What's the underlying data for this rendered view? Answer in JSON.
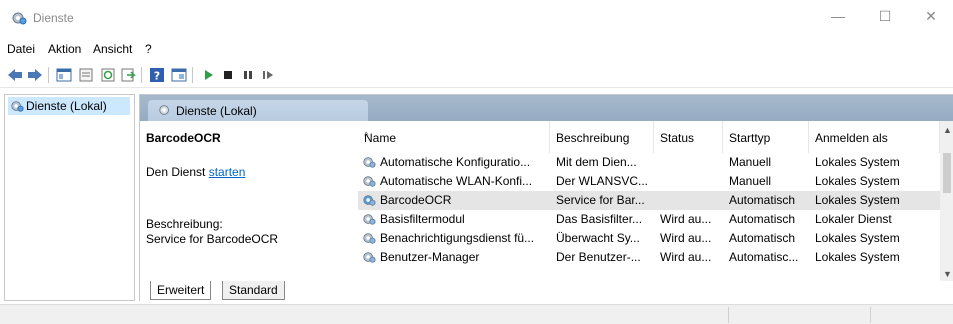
{
  "window": {
    "title": "Dienste",
    "minimize": "—",
    "maximize": "☐",
    "close": "✕"
  },
  "menu": {
    "items": [
      "Datei",
      "Aktion",
      "Ansicht",
      "?"
    ]
  },
  "toolbar": {
    "icons": [
      "back-icon",
      "forward-icon",
      "console-tree-icon",
      "properties-icon",
      "refresh-icon",
      "export-icon",
      "help-icon",
      "view-icon",
      "start-icon",
      "stop-icon",
      "pause-icon",
      "restart-icon"
    ]
  },
  "left_pane": {
    "items": [
      {
        "label": "Dienste (Lokal)"
      }
    ]
  },
  "header": {
    "tab_label": "Dienste (Lokal)"
  },
  "description": {
    "title": "BarcodeOCR",
    "action_prefix": "Den Dienst ",
    "action_link": "starten",
    "label": "Beschreibung:",
    "text": "Service for BarcodeOCR"
  },
  "table": {
    "columns": [
      "Name",
      "Beschreibung",
      "Status",
      "Starttyp",
      "Anmelden als"
    ],
    "sort_indicator": "^",
    "rows": [
      {
        "name": "Automatische Konfiguratio...",
        "desc": "Mit dem Dien...",
        "status": "",
        "start": "Manuell",
        "logon": "Lokales System",
        "selected": false
      },
      {
        "name": "Automatische WLAN-Konfi...",
        "desc": "Der WLANSVC...",
        "status": "",
        "start": "Manuell",
        "logon": "Lokales System",
        "selected": false
      },
      {
        "name": "BarcodeOCR",
        "desc": "Service for Bar...",
        "status": "",
        "start": "Automatisch",
        "logon": "Lokales System",
        "selected": true
      },
      {
        "name": "Basisfiltermodul",
        "desc": "Das Basisfilter...",
        "status": "Wird au...",
        "start": "Automatisch",
        "logon": "Lokaler Dienst",
        "selected": false
      },
      {
        "name": "Benachrichtigungsdienst fü...",
        "desc": "Überwacht Sy...",
        "status": "Wird au...",
        "start": "Automatisch",
        "logon": "Lokales System",
        "selected": false
      },
      {
        "name": "Benutzer-Manager",
        "desc": "Der Benutzer-...",
        "status": "Wird au...",
        "start": "Automatisc...",
        "logon": "Lokales System",
        "selected": false
      }
    ]
  },
  "bottom_tabs": [
    "Erweitert",
    "Standard"
  ],
  "colors": {
    "selection": "#cce8ff",
    "header_band": "#a7b9cc",
    "link": "#0066cc"
  }
}
